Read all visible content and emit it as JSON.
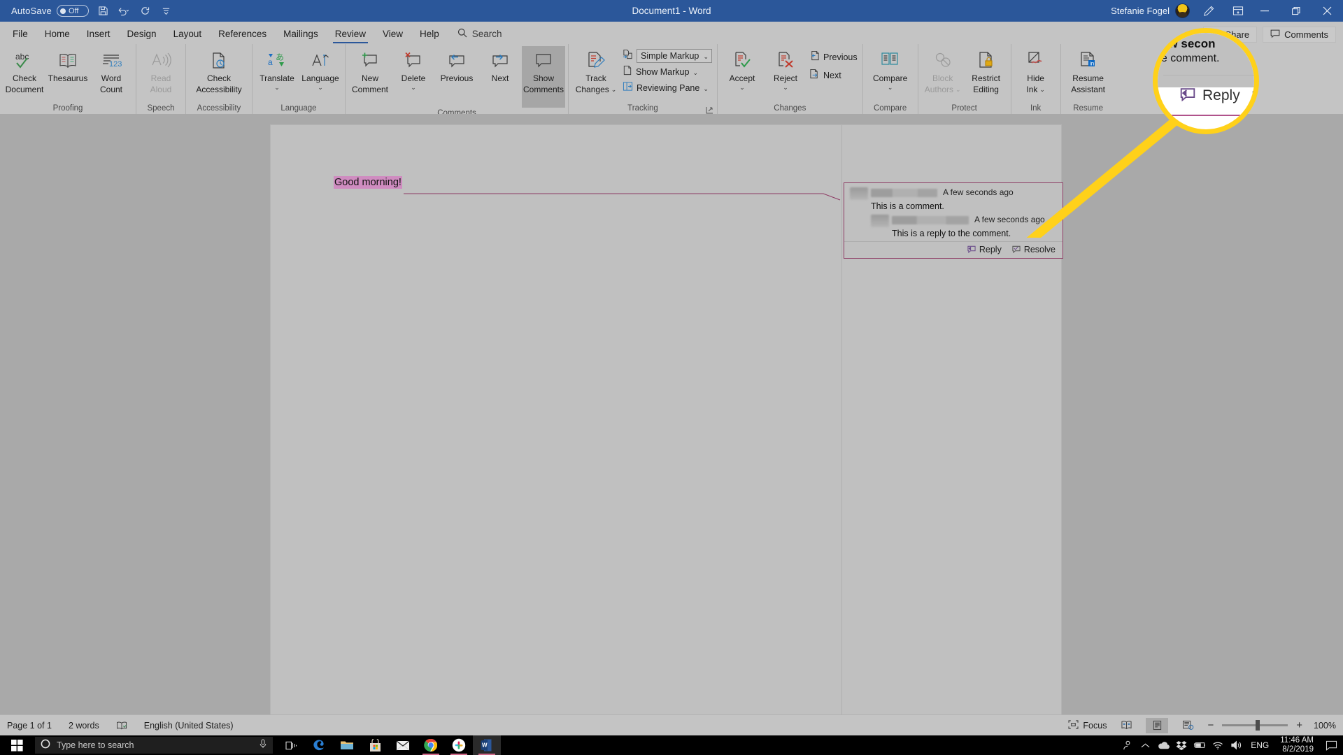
{
  "titlebar": {
    "autosave_label": "AutoSave",
    "autosave_state": "Off",
    "save_icon": "save-icon",
    "undo_icon": "undo-icon",
    "redo_icon": "redo-icon",
    "customize_icon": "customize-quick-access-icon",
    "document_title": "Document1  -  Word",
    "user_name": "Stefanie Fogel",
    "avatar_icon": "user-avatar",
    "ink_icon": "pen-icon",
    "ribbon_display_icon": "ribbon-display-options-icon",
    "minimize_icon": "minimize-icon",
    "restore_icon": "restore-icon",
    "close_icon": "close-icon"
  },
  "tabs": [
    {
      "label": "File",
      "active": false
    },
    {
      "label": "Home",
      "active": false
    },
    {
      "label": "Insert",
      "active": false
    },
    {
      "label": "Design",
      "active": false
    },
    {
      "label": "Layout",
      "active": false
    },
    {
      "label": "References",
      "active": false
    },
    {
      "label": "Mailings",
      "active": false
    },
    {
      "label": "Review",
      "active": true
    },
    {
      "label": "View",
      "active": false
    },
    {
      "label": "Help",
      "active": false
    }
  ],
  "search": {
    "label": "Search",
    "icon": "search-icon"
  },
  "topright": {
    "share_label": "Share",
    "share_icon": "share-icon",
    "comments_label": "Comments",
    "comments_icon": "comment-icon"
  },
  "ribbon": {
    "groups": [
      {
        "name": "Proofing",
        "buttons": [
          {
            "label1": "Check",
            "label2": "Document",
            "icon": "spelling-check-icon",
            "disabled": false
          },
          {
            "label1": "Thesaurus",
            "label2": "",
            "icon": "thesaurus-icon",
            "disabled": false
          },
          {
            "label1": "Word",
            "label2": "Count",
            "icon": "word-count-icon",
            "disabled": false
          }
        ]
      },
      {
        "name": "Speech",
        "buttons": [
          {
            "label1": "Read",
            "label2": "Aloud",
            "icon": "read-aloud-icon",
            "disabled": true
          }
        ]
      },
      {
        "name": "Accessibility",
        "buttons": [
          {
            "label1": "Check",
            "label2": "Accessibility",
            "icon": "check-accessibility-icon",
            "disabled": false
          }
        ]
      },
      {
        "name": "Language",
        "buttons": [
          {
            "label1": "Translate",
            "label2": "",
            "icon": "translate-icon",
            "dropdown": true,
            "disabled": false
          },
          {
            "label1": "Language",
            "label2": "",
            "icon": "language-icon",
            "dropdown": true,
            "disabled": false
          }
        ]
      },
      {
        "name": "Comments",
        "buttons": [
          {
            "label1": "New",
            "label2": "Comment",
            "icon": "new-comment-icon",
            "disabled": false
          },
          {
            "label1": "Delete",
            "label2": "",
            "icon": "delete-comment-icon",
            "dropdown": true,
            "disabled": false
          },
          {
            "label1": "Previous",
            "label2": "",
            "icon": "previous-comment-icon",
            "disabled": false
          },
          {
            "label1": "Next",
            "label2": "",
            "icon": "next-comment-icon",
            "disabled": false
          },
          {
            "label1": "Show",
            "label2": "Comments",
            "icon": "show-comments-icon",
            "disabled": false,
            "active": true
          }
        ]
      },
      {
        "name": "Tracking",
        "track_changes": {
          "label1": "Track",
          "label2": "Changes",
          "icon": "track-changes-icon",
          "dropdown": true
        },
        "markup_dropdown": {
          "value": "Simple Markup",
          "icon": "display-for-review-icon"
        },
        "show_markup": {
          "label": "Show Markup",
          "icon": "show-markup-icon"
        },
        "reviewing_pane": {
          "label": "Reviewing Pane",
          "icon": "reviewing-pane-icon"
        },
        "has_dialog_launcher": true
      },
      {
        "name": "Changes",
        "buttons": [
          {
            "label1": "Accept",
            "label2": "",
            "icon": "accept-change-icon",
            "dropdown": true,
            "disabled": false
          },
          {
            "label1": "Reject",
            "label2": "",
            "icon": "reject-change-icon",
            "dropdown": true,
            "disabled": false
          }
        ],
        "small": [
          {
            "label": "Previous",
            "icon": "previous-change-icon"
          },
          {
            "label": "Next",
            "icon": "next-change-icon"
          }
        ]
      },
      {
        "name": "Compare",
        "buttons": [
          {
            "label1": "Compare",
            "label2": "",
            "icon": "compare-icon",
            "dropdown": true,
            "disabled": false
          }
        ]
      },
      {
        "name": "Protect",
        "buttons": [
          {
            "label1": "Block",
            "label2": "Authors",
            "icon": "block-authors-icon",
            "dropdown": true,
            "disabled": true
          },
          {
            "label1": "Restrict",
            "label2": "Editing",
            "icon": "restrict-editing-icon",
            "disabled": false
          }
        ]
      },
      {
        "name": "Ink",
        "buttons": [
          {
            "label1": "Hide",
            "label2": "Ink",
            "icon": "hide-ink-icon",
            "dropdown": true,
            "disabled": false
          }
        ]
      },
      {
        "name": "Resume",
        "buttons": [
          {
            "label1": "Resume",
            "label2": "Assistant",
            "icon": "resume-assistant-icon",
            "disabled": false
          }
        ]
      }
    ]
  },
  "document": {
    "text": "Good morning!",
    "highlight_color": "#cf8cc0",
    "anchor_line_color": "#8d3a63"
  },
  "comment_pane": {
    "thread": {
      "author_redacted": true,
      "timestamp": "A few seconds ago",
      "text": "This is a comment.",
      "reply": {
        "author_redacted": true,
        "timestamp": "A few seconds ago",
        "text": "This is a reply to the comment."
      },
      "actions": {
        "reply_label": "Reply",
        "reply_icon": "reply-icon",
        "resolve_label": "Resolve",
        "resolve_icon": "resolve-icon"
      }
    }
  },
  "callout": {
    "partial_timestamp": "ew secon",
    "partial_text": "he comment.",
    "reply_label": "Reply",
    "reply_icon": "reply-icon",
    "resolve_icon": "resolve-icon",
    "ring_color": "#ffd11a"
  },
  "statusbar": {
    "page": "Page 1 of 1",
    "words": "2 words",
    "proofing_icon": "proofing-status-icon",
    "language": "English (United States)",
    "focus_label": "Focus",
    "focus_icon": "focus-icon",
    "views": [
      {
        "icon": "read-mode-icon",
        "selected": false
      },
      {
        "icon": "print-layout-icon",
        "selected": true
      },
      {
        "icon": "web-layout-icon",
        "selected": false
      }
    ],
    "zoom_minus": "−",
    "zoom_plus": "+",
    "zoom_percent": "100%"
  },
  "taskbar": {
    "start_icon": "windows-start-icon",
    "search_placeholder": "Type here to search",
    "search_circle_icon": "cortana-icon",
    "mic_icon": "microphone-icon",
    "task_view_icon": "task-view-icon",
    "apps": [
      {
        "name": "edge-icon",
        "running": false
      },
      {
        "name": "file-explorer-icon",
        "running": false
      },
      {
        "name": "microsoft-store-icon",
        "running": false
      },
      {
        "name": "mail-icon",
        "running": false
      },
      {
        "name": "chrome-icon",
        "running": true
      },
      {
        "name": "slack-icon",
        "running": true
      },
      {
        "name": "word-icon",
        "running": true,
        "active": true
      }
    ],
    "tray": [
      {
        "name": "people-icon"
      },
      {
        "name": "show-hidden-icons-icon"
      },
      {
        "name": "onedrive-icon"
      },
      {
        "name": "dropbox-icon"
      },
      {
        "name": "battery-icon"
      },
      {
        "name": "wifi-icon"
      },
      {
        "name": "volume-icon"
      }
    ],
    "language": "ENG",
    "time": "11:46 AM",
    "date": "8/2/2019",
    "action_center_icon": "action-center-icon"
  }
}
